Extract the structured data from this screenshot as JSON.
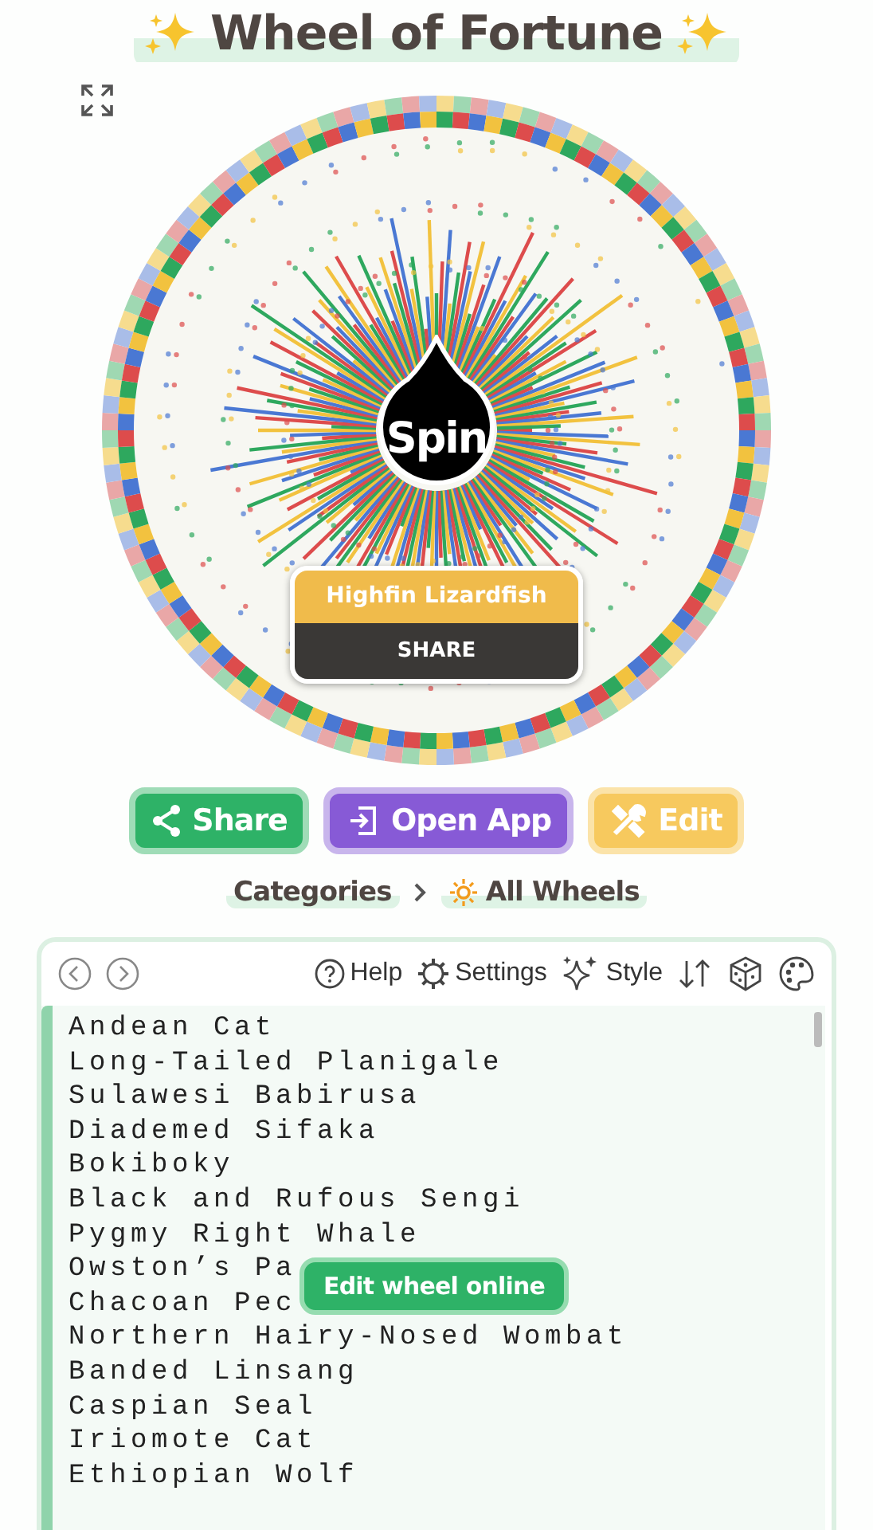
{
  "title": "Wheel of Fortune",
  "wheel": {
    "spin_label": "Spin",
    "result": {
      "label": "Highfin Lizardfish",
      "action": "SHARE"
    }
  },
  "actions": [
    {
      "kind": "share",
      "label": "Share"
    },
    {
      "kind": "open",
      "label": "Open App"
    },
    {
      "kind": "edit",
      "label": "Edit"
    }
  ],
  "breadcrumb": [
    {
      "kind": "plain",
      "label": "Categories"
    },
    {
      "kind": "sun",
      "label": "All Wheels"
    }
  ],
  "toolbar": [
    {
      "kind": "back"
    },
    {
      "kind": "forward"
    },
    {
      "kind": "help",
      "label": "Help"
    },
    {
      "kind": "settings",
      "label": "Settings"
    },
    {
      "kind": "style",
      "label": "Style"
    },
    {
      "kind": "sort"
    },
    {
      "kind": "dice"
    },
    {
      "kind": "palette"
    }
  ],
  "entries": [
    "Andean Cat",
    "Long-Tailed Planigale",
    "Sulawesi Babirusa",
    "Diademed Sifaka",
    "Bokiboky",
    "Black and Rufous Sengi",
    "Pygmy Right Whale",
    "Owston’s Pa",
    "Chacoan Pec",
    "Northern Hairy-Nosed Wombat",
    "Banded Linsang",
    "Caspian Seal",
    "Iriomote Cat",
    "Ethiopian Wolf"
  ],
  "edit_online": "Edit wheel online"
}
